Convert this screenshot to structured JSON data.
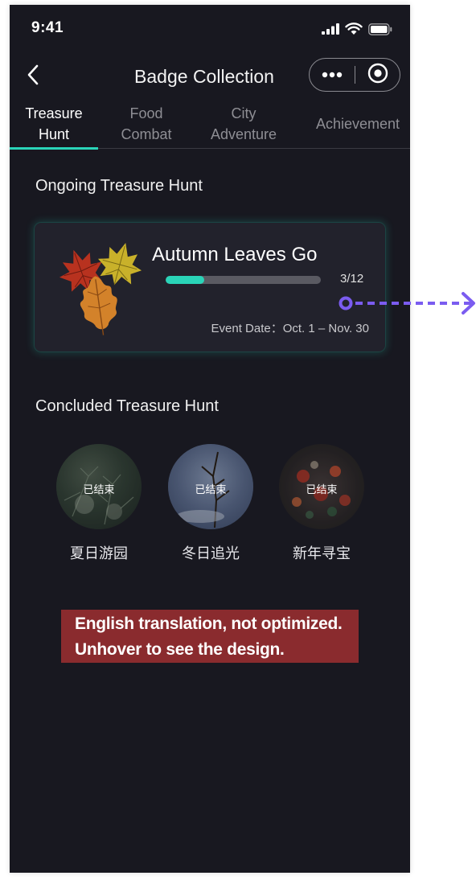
{
  "status_bar": {
    "time": "9:41"
  },
  "nav": {
    "title": "Badge Collection",
    "back_icon": "chevron-left-icon",
    "more_icon": "more-dots-icon",
    "close_icon": "target-circle-icon"
  },
  "tabs": [
    {
      "label": "Treasure\nHunt",
      "active": true
    },
    {
      "label": "Food\nCombat",
      "active": false
    },
    {
      "label": "City\nAdventure",
      "active": false
    },
    {
      "label": "Achievement",
      "active": false
    }
  ],
  "ongoing": {
    "section_title": "Ongoing Treasure Hunt",
    "card": {
      "title": "Autumn Leaves Go",
      "progress_label": "3/12",
      "progress_fraction": 0.25,
      "event_date": "Event Date：Oct. 1 – Nov. 30"
    }
  },
  "concluded": {
    "section_title": "Concluded Treasure Hunt",
    "items": [
      {
        "badge": "已结束",
        "label": "夏日游园"
      },
      {
        "badge": "已结束",
        "label": "冬日追光"
      },
      {
        "badge": "已结束",
        "label": "新年寻宝"
      }
    ]
  },
  "note": {
    "line1": "English translation, not optimized.",
    "line2": "Unhover to see the design."
  },
  "colors": {
    "background": "#181820",
    "accent": "#2ad4b8",
    "note_bg": "#8a2b2e",
    "annotation": "#7b5cf0"
  }
}
